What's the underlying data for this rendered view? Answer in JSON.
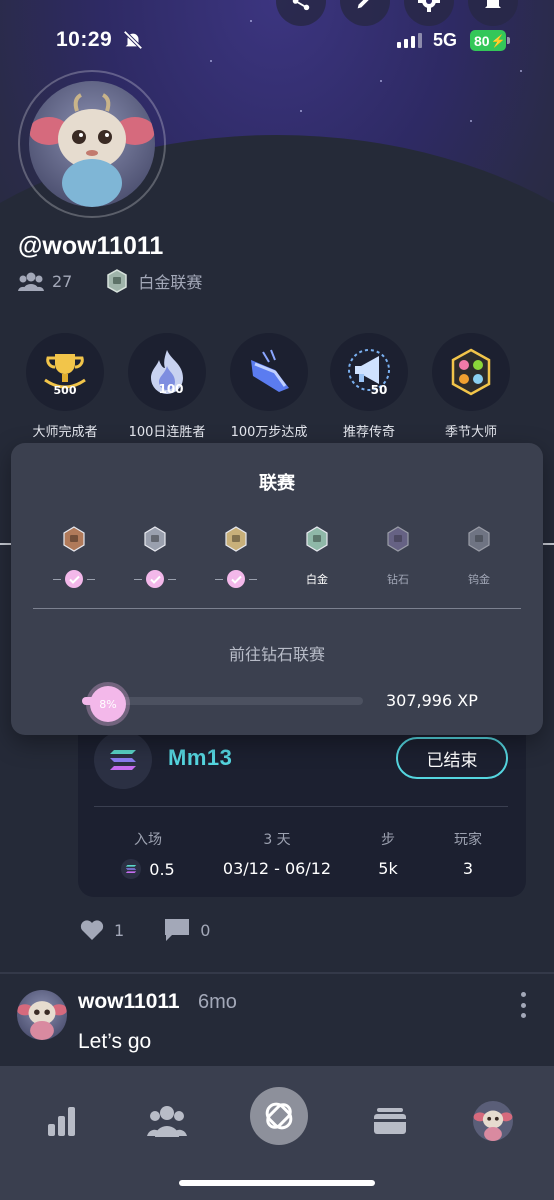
{
  "status_bar": {
    "time": "10:29",
    "network": "5G",
    "battery": "80"
  },
  "profile": {
    "username": "@wow11011",
    "followers": "27",
    "league": "白金联赛"
  },
  "achievements": [
    {
      "label": "大师完成者",
      "badge": "500",
      "icon": "trophy-icon"
    },
    {
      "label": "100日连胜者",
      "badge": "100",
      "icon": "flame-icon"
    },
    {
      "label": "100万步达成",
      "badge": "",
      "icon": "sneaker-icon"
    },
    {
      "label": "推荐传奇",
      "badge": "50",
      "icon": "megaphone-icon"
    },
    {
      "label": "季节大师",
      "badge": "",
      "icon": "seasons-icon"
    }
  ],
  "league_popup": {
    "title": "联赛",
    "tiers": [
      {
        "name": "bronze",
        "label": "",
        "completed": true,
        "color": "#b07a5a"
      },
      {
        "name": "silver",
        "label": "",
        "completed": true,
        "color": "#9aa0ae"
      },
      {
        "name": "gold",
        "label": "",
        "completed": true,
        "color": "#c8b07a"
      },
      {
        "name": "platinum",
        "label": "白金",
        "completed": false,
        "color": "#8fb8a8"
      },
      {
        "name": "diamond",
        "label": "钻石",
        "completed": false,
        "color": "#8a7fb0"
      },
      {
        "name": "titanium",
        "label": "钨金",
        "completed": false,
        "color": "#9aa0ae"
      }
    ],
    "next_goal": "前往钻石联赛",
    "progress_label": "8%",
    "progress": 0.08,
    "xp": "307,996 XP"
  },
  "challenge": {
    "name": "Mm13",
    "status": "已结束",
    "stats": {
      "entry_label": "入场",
      "entry_value": "0.5",
      "duration_label": "3 天",
      "duration_value": "03/12 - 06/12",
      "steps_label": "步",
      "steps_value": "5k",
      "players_label": "玩家",
      "players_value": "3"
    }
  },
  "reactions": {
    "likes": "1",
    "comments": "0"
  },
  "comment": {
    "user": "wow11011",
    "time": "6mo",
    "text": "Let’s go"
  },
  "colors": {
    "accent": "#55d6e0",
    "progress": "#f3b8ea",
    "background": "#252a38"
  }
}
